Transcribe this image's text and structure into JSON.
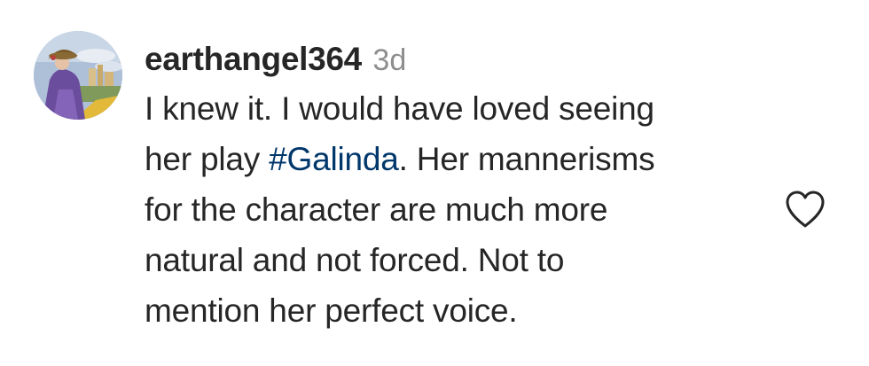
{
  "comment": {
    "username": "earthangel364",
    "time": "3d",
    "lines": [
      {
        "before": "I knew it. I would have loved seeing",
        "hashtag": "",
        "after": ""
      },
      {
        "before": "her play ",
        "hashtag": "#Galinda",
        "after": ". Her mannerisms"
      },
      {
        "before": "for the character are much more",
        "hashtag": "",
        "after": ""
      },
      {
        "before": "natural and not forced. Not to",
        "hashtag": "",
        "after": ""
      },
      {
        "before": "mention her perfect voice.",
        "hashtag": "",
        "after": ""
      }
    ],
    "like_icon": "heart-outline-icon"
  },
  "colors": {
    "text": "#262626",
    "muted": "#8e8e8e",
    "hashtag": "#00376b",
    "background": "#ffffff"
  }
}
